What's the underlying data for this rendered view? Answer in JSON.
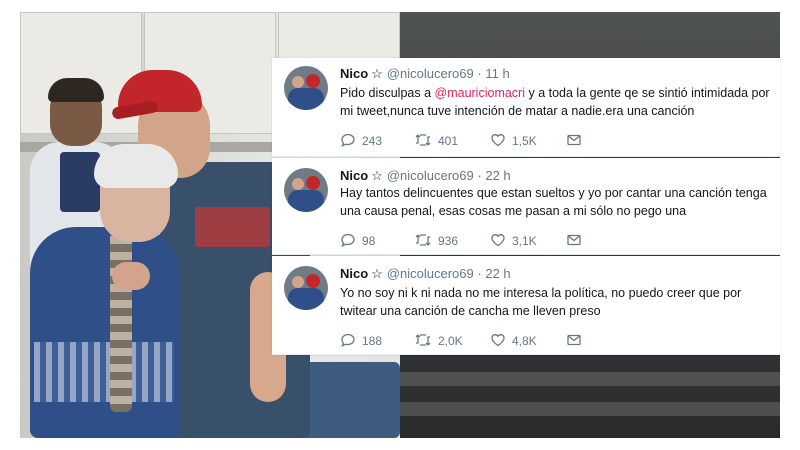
{
  "tweets": [
    {
      "name": "Nico",
      "handle": "@nicolucero69",
      "time": "11 h",
      "text_before": "Pido disculpas a ",
      "mention": "@mauriciomacri",
      "text_after": " y a toda la gente qe se sintió intimidada por mi tweet,nunca tuve intención de matar a nadie.era una canción",
      "replies": "243",
      "retweets": "401",
      "likes": "1,5K"
    },
    {
      "name": "Nico",
      "handle": "@nicolucero69",
      "time": "22 h",
      "text_before": "Hay tantos delincuentes que estan sueltos y yo por cantar una canción tenga una causa penal, esas cosas me pasan a mi sólo no pego una",
      "replies": "98",
      "retweets": "936",
      "likes": "3,1K"
    },
    {
      "name": "Nico",
      "handle": "@nicolucero69",
      "time": "22 h",
      "text_before": "Yo no soy ni k ni nada no me interesa la política, no puedo creer que por twitear una canción de cancha me lleven preso",
      "replies": "188",
      "retweets": "2,0K",
      "likes": "4,8K"
    }
  ],
  "separator": "·",
  "icons": {
    "reply": "reply-icon",
    "retweet": "retweet-icon",
    "like": "heart-icon",
    "message": "envelope-icon",
    "badge": "star-icon"
  },
  "colors": {
    "mention": "#e0245e",
    "secondary_text": "#657786",
    "primary_text": "#14171a"
  }
}
